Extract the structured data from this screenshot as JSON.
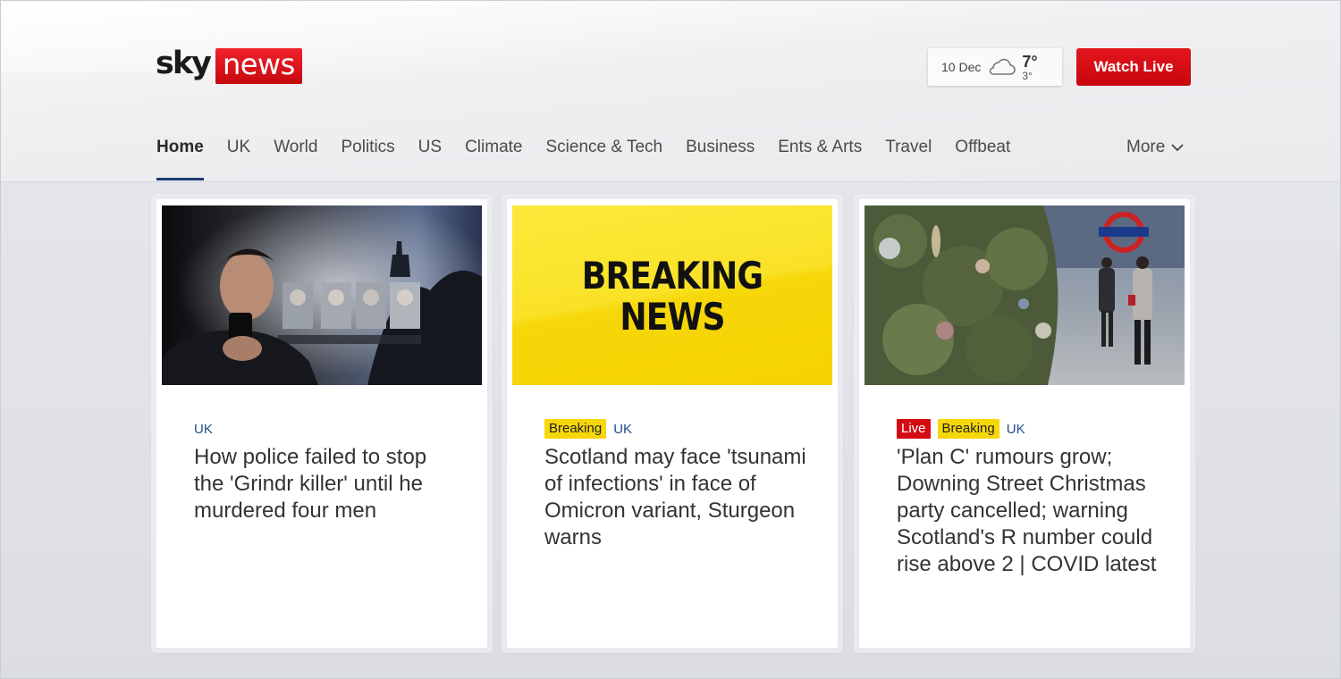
{
  "header": {
    "logo": {
      "sky": "sky",
      "news": "news"
    },
    "weather": {
      "date": "10 Dec",
      "high": "7°",
      "low": "3°",
      "icon": "cloud-icon"
    },
    "watch_live_label": "Watch Live"
  },
  "nav": {
    "items": [
      {
        "label": "Home",
        "active": true
      },
      {
        "label": "UK"
      },
      {
        "label": "World"
      },
      {
        "label": "Politics"
      },
      {
        "label": "US"
      },
      {
        "label": "Climate"
      },
      {
        "label": "Science & Tech"
      },
      {
        "label": "Business"
      },
      {
        "label": "Ents & Arts"
      },
      {
        "label": "Travel"
      },
      {
        "label": "Offbeat"
      }
    ],
    "more_label": "More"
  },
  "cards": [
    {
      "tags": [],
      "category": "UK",
      "headline": "How police failed to stop the 'Grindr killer' until he murdered four men"
    },
    {
      "image_text_line1": "BREAKING",
      "image_text_line2": "NEWS",
      "tags": [
        "Breaking"
      ],
      "category": "UK",
      "headline": "Scotland may face 'tsunami of infections' in face of Omicron variant, Sturgeon warns"
    },
    {
      "tags": [
        "Live",
        "Breaking"
      ],
      "category": "UK",
      "headline": "'Plan C' rumours grow; Downing Street Christmas party cancelled; warning Scotland's R number could rise above 2 | COVID latest"
    }
  ],
  "colors": {
    "brand_red": "#d40b13",
    "breaking_yellow": "#f6d70a",
    "nav_active_underline": "#1d3a6e",
    "category_blue": "#1f4d8f"
  }
}
